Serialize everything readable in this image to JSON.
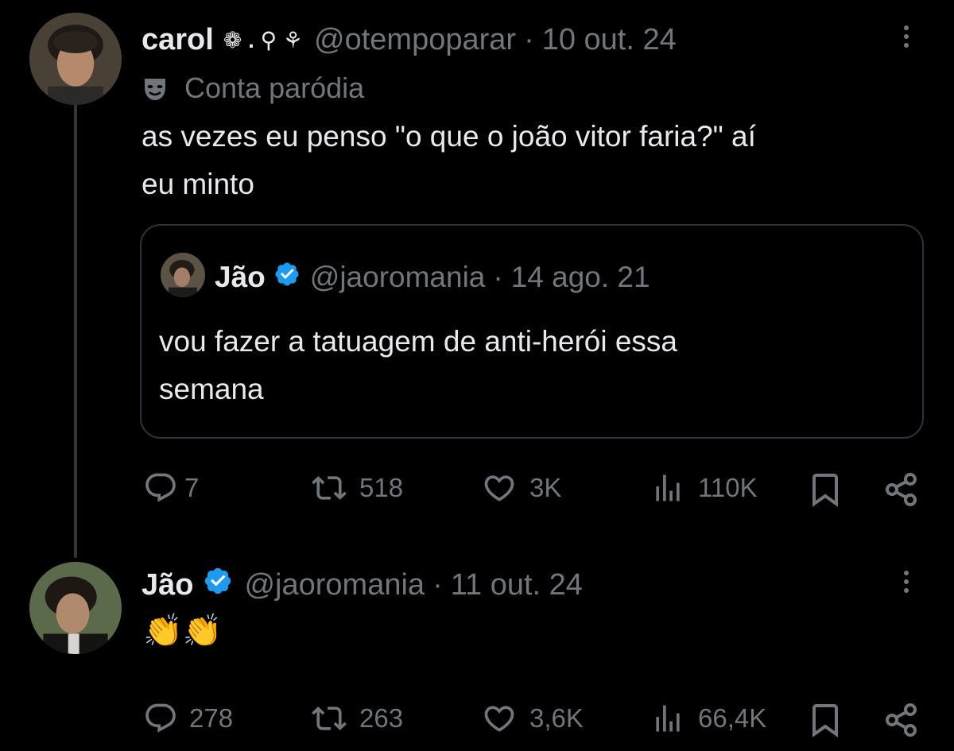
{
  "tweet": {
    "author_name": "carol",
    "name_symbols": "❁ . ⚲ ⚘",
    "handle": "@otempoparar",
    "separator": "·",
    "date": "10 out. 24",
    "label": "Conta paródia",
    "text_line1": "as vezes eu penso \"o que o joão vitor faria?\" aí",
    "text_line2": "eu minto",
    "quote": {
      "author_name": "Jão",
      "handle": "@jaoromania",
      "separator": "·",
      "date": "14 ago. 21",
      "text_line1": "vou fazer a tatuagem de anti-herói essa",
      "text_line2": "semana"
    },
    "actions": {
      "replies": "7",
      "retweets": "518",
      "likes": "3K",
      "views": "110K"
    }
  },
  "reply": {
    "author_name": "Jão",
    "handle": "@jaoromania",
    "separator": "·",
    "date": "11 out. 24",
    "text": "👏👏",
    "actions": {
      "replies": "278",
      "retweets": "263",
      "likes": "3,6K",
      "views": "66,4K"
    }
  },
  "colors": {
    "background": "#000000",
    "text": "#e7e9ea",
    "muted": "#71767b",
    "verified": "#1d9bf0",
    "border": "#2f3336"
  },
  "icons": [
    "reply-icon",
    "retweet-icon",
    "like-icon",
    "views-icon",
    "bookmark-icon",
    "share-icon",
    "more-icon",
    "verified-icon",
    "parody-mask-icon"
  ]
}
